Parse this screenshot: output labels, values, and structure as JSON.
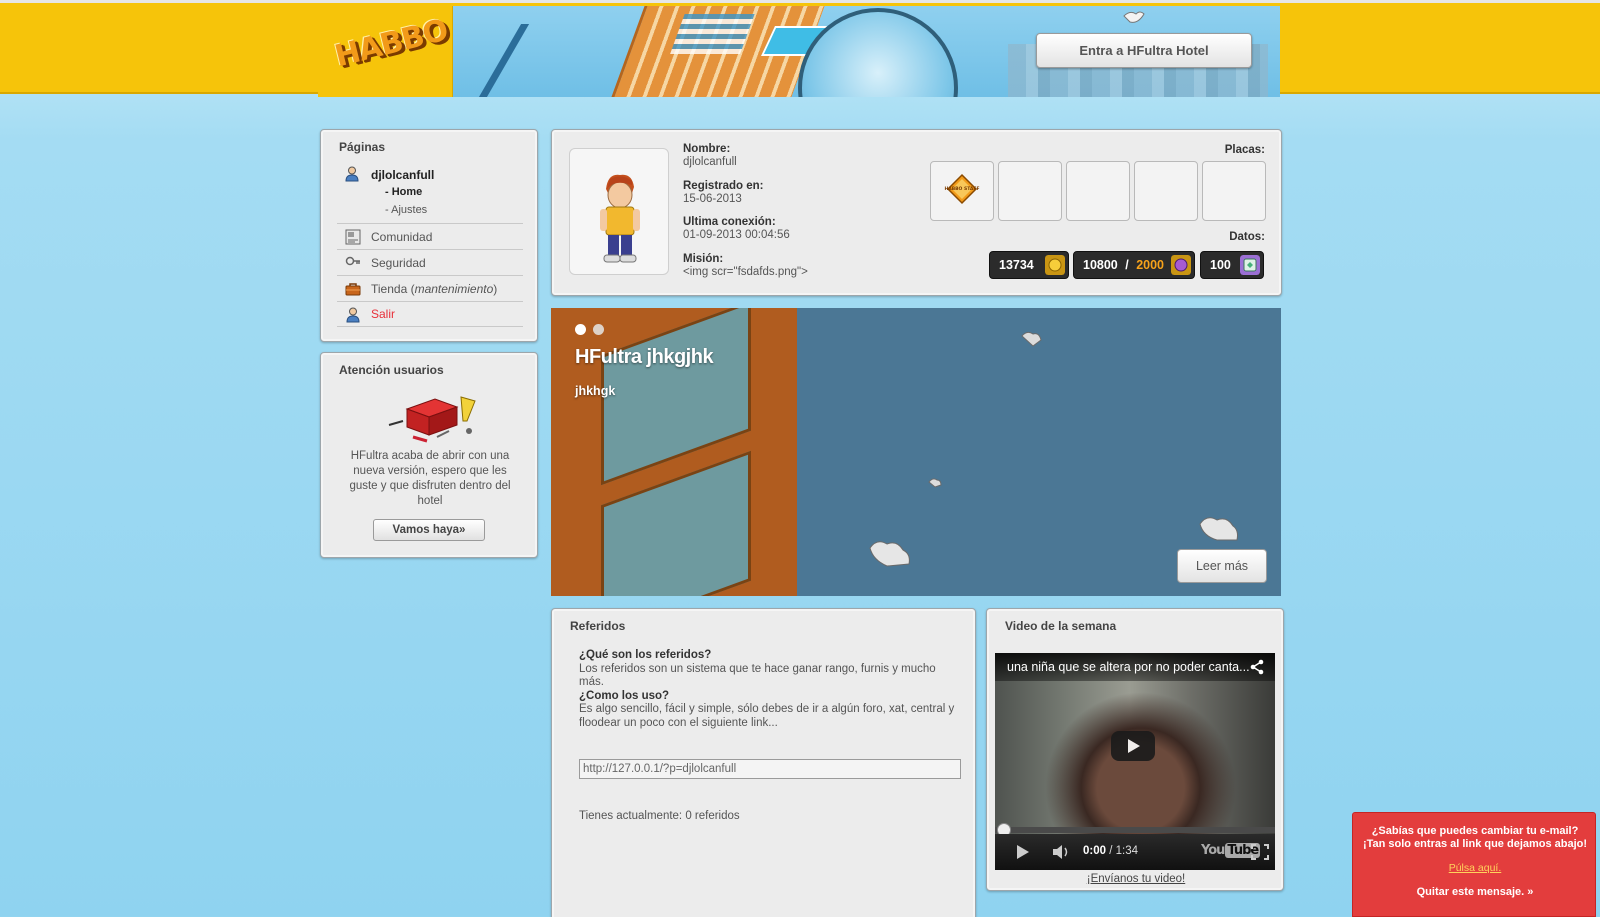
{
  "header": {
    "logo_text": "HABBO",
    "enter_button": "Entra a HFultra Hotel"
  },
  "nav": {
    "title": "Páginas",
    "user_name": "djlolcanfull",
    "sub_home": "- Home",
    "sub_ajustes": "- Ajustes",
    "items": [
      {
        "label": "Comunidad",
        "icon": "community-icon"
      },
      {
        "label": "Seguridad",
        "icon": "key-icon"
      },
      {
        "label": "Tienda (",
        "label_em": "mantenimiento",
        "label_tail": ")",
        "icon": "shop-icon"
      },
      {
        "label": "Salir",
        "icon": "user-icon"
      }
    ]
  },
  "atencion": {
    "title": "Atención usuarios",
    "text": "HFultra acaba de abrir con una nueva versión, espero que les guste y que disfruten dentro del hotel",
    "button": "Vamos haya»"
  },
  "profile": {
    "nombre_label": "Nombre:",
    "nombre_value": "djlolcanfull",
    "registrado_label": "Registrado en:",
    "registrado_value": "15-06-2013",
    "conexion_label": "Ultima conexión:",
    "conexion_value": "01-09-2013 00:04:56",
    "mision_label": "Misión:",
    "mision_value": "<img scr=\"fsdafds.png\">",
    "placas_label": "Placas:",
    "badge_text": "HABBO STAFF",
    "datos_label": "Datos:",
    "credits": "13734",
    "duckets": "10800",
    "duckets_sep": " / ",
    "duckets_max": "2000",
    "diamonds": "100"
  },
  "slider": {
    "title": "HFultra jhkgjhk",
    "subtitle": "jhkhgk",
    "button": "Leer más"
  },
  "referidos": {
    "title": "Referidos",
    "q1": "¿Qué son los referidos?",
    "a1": "Los referidos son un sistema que te hace ganar rango, furnis y mucho más.",
    "q2": "¿Como los uso?",
    "a2": "Es algo sencillo, fácil y simple, sólo debes de ir a algún foro, xat, central y floodear un poco con el siguiente link...",
    "link_value": "http://127.0.0.1/?p=djlolcanfull",
    "count_text": "Tienes actualmente: 0 referidos"
  },
  "video": {
    "title": "Video de la semana",
    "video_title": "una niña que se altera por no poder canta...",
    "time_current": "0:00",
    "time_total": " / 1:34",
    "logo_you": "You",
    "logo_tube": "Tube",
    "link": "¡Envíanos tu video!"
  },
  "notice": {
    "line1": "¿Sabías que puedes cambiar tu e-mail?",
    "line2": "¡Tan solo entras al link que dejamos abajo!",
    "link": "Púlsa aquí.",
    "close": "Quitar este mensaje. »"
  },
  "colors": {
    "header_yellow": "#f6c40a",
    "sky_blue": "#8fd3f0",
    "slider_blue": "#4b7795",
    "salir_red": "#e8303a",
    "notice_red": "#e33d3d",
    "ducket_orange": "#f7a21a"
  }
}
